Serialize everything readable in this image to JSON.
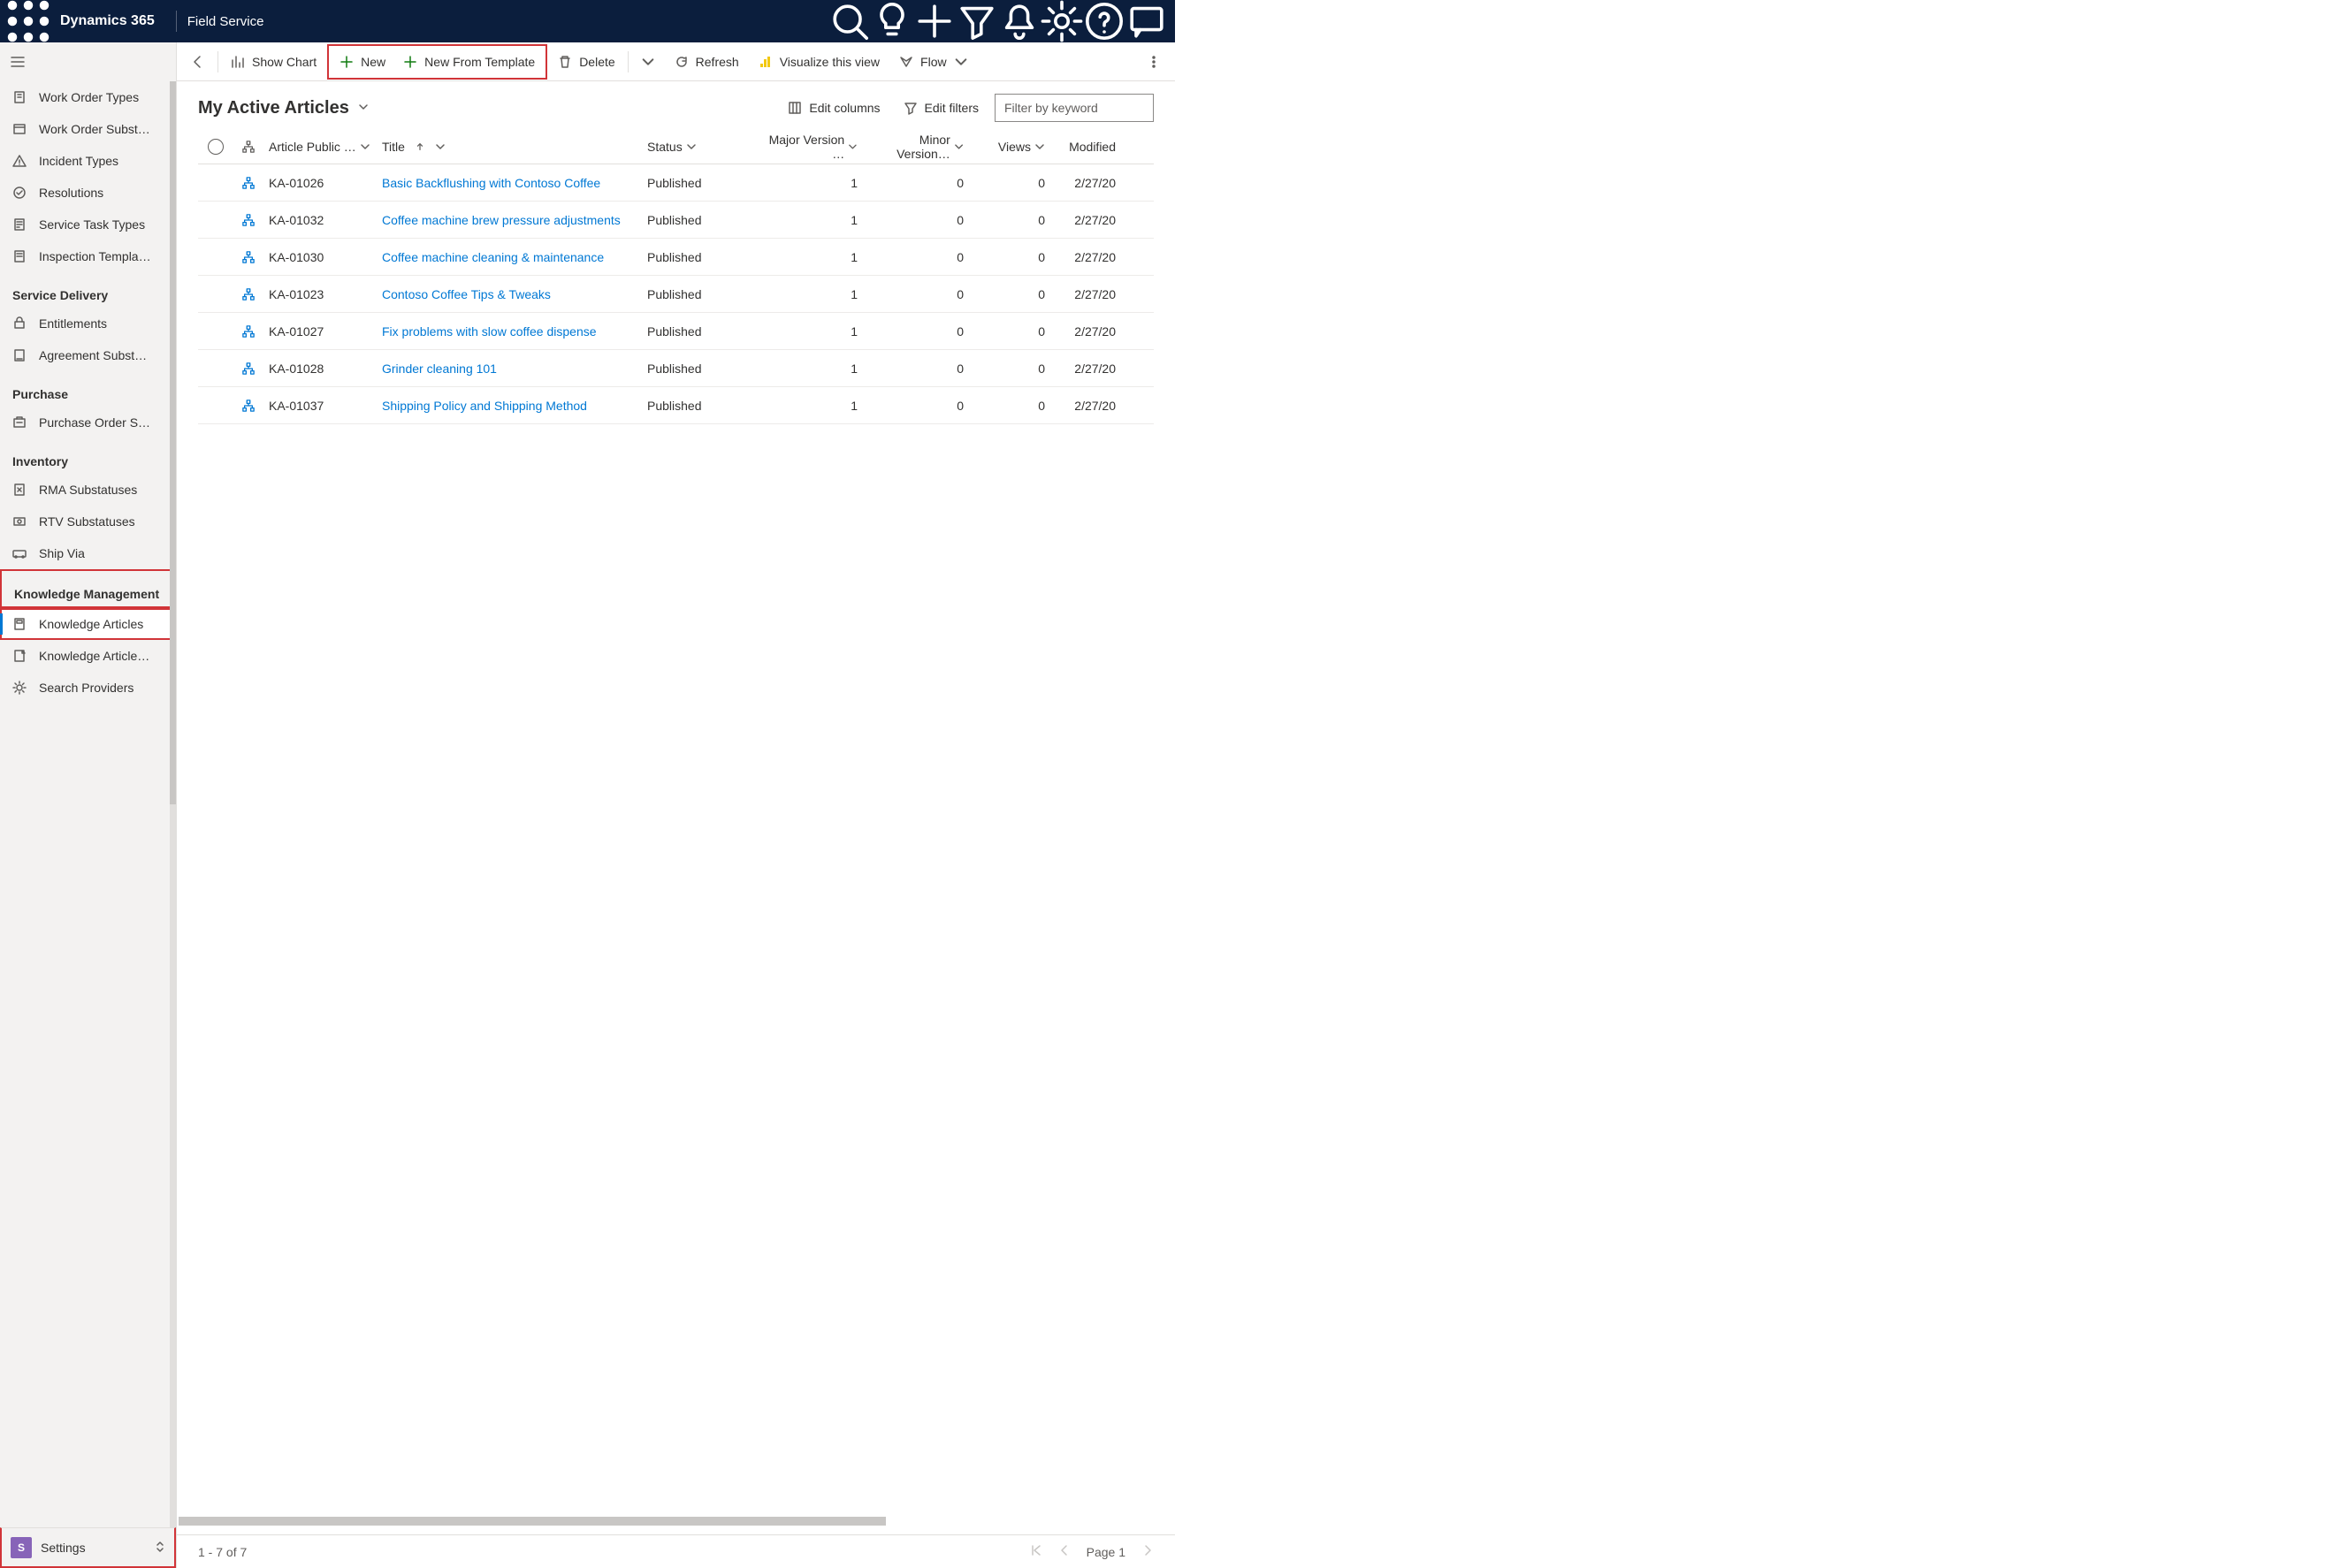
{
  "header": {
    "brand": "Dynamics 365",
    "app_name": "Field Service"
  },
  "sidebar": {
    "items_top": [
      {
        "label": "Work Order Types"
      },
      {
        "label": "Work Order Subst…"
      },
      {
        "label": "Incident Types"
      },
      {
        "label": "Resolutions"
      },
      {
        "label": "Service Task Types"
      },
      {
        "label": "Inspection Templa…"
      }
    ],
    "groups": [
      {
        "title": "Service Delivery",
        "items": [
          {
            "label": "Entitlements"
          },
          {
            "label": "Agreement Subst…"
          }
        ]
      },
      {
        "title": "Purchase",
        "items": [
          {
            "label": "Purchase Order S…"
          }
        ]
      },
      {
        "title": "Inventory",
        "items": [
          {
            "label": "RMA Substatuses"
          },
          {
            "label": "RTV Substatuses"
          },
          {
            "label": "Ship Via"
          }
        ]
      },
      {
        "title": "Knowledge Management",
        "highlighted": true,
        "items": [
          {
            "label": "Knowledge Articles",
            "selected": true
          },
          {
            "label": "Knowledge Article…"
          },
          {
            "label": "Search Providers"
          }
        ]
      }
    ],
    "area": {
      "badge": "S",
      "label": "Settings"
    }
  },
  "commands": {
    "show_chart": "Show Chart",
    "new": "New",
    "new_from_template": "New From Template",
    "delete": "Delete",
    "refresh": "Refresh",
    "visualize": "Visualize this view",
    "flow": "Flow"
  },
  "view": {
    "title": "My Active Articles",
    "edit_columns": "Edit columns",
    "edit_filters": "Edit filters",
    "filter_placeholder": "Filter by keyword"
  },
  "grid": {
    "columns": {
      "article_public": "Article Public …",
      "title": "Title",
      "status": "Status",
      "major": "Major Version …",
      "minor": "Minor Version…",
      "views": "Views",
      "modified": "Modified"
    },
    "rows": [
      {
        "pub": "KA-01026",
        "title": "Basic Backflushing with Contoso Coffee",
        "status": "Published",
        "major": "1",
        "minor": "0",
        "views": "0",
        "mod": "2/27/20"
      },
      {
        "pub": "KA-01032",
        "title": "Coffee machine brew pressure adjustments",
        "status": "Published",
        "major": "1",
        "minor": "0",
        "views": "0",
        "mod": "2/27/20"
      },
      {
        "pub": "KA-01030",
        "title": "Coffee machine cleaning & maintenance",
        "status": "Published",
        "major": "1",
        "minor": "0",
        "views": "0",
        "mod": "2/27/20"
      },
      {
        "pub": "KA-01023",
        "title": "Contoso Coffee Tips & Tweaks",
        "status": "Published",
        "major": "1",
        "minor": "0",
        "views": "0",
        "mod": "2/27/20"
      },
      {
        "pub": "KA-01027",
        "title": "Fix problems with slow coffee dispense",
        "status": "Published",
        "major": "1",
        "minor": "0",
        "views": "0",
        "mod": "2/27/20"
      },
      {
        "pub": "KA-01028",
        "title": "Grinder cleaning 101",
        "status": "Published",
        "major": "1",
        "minor": "0",
        "views": "0",
        "mod": "2/27/20"
      },
      {
        "pub": "KA-01037",
        "title": "Shipping Policy and Shipping Method",
        "status": "Published",
        "major": "1",
        "minor": "0",
        "views": "0",
        "mod": "2/27/20"
      }
    ]
  },
  "footer": {
    "range": "1 - 7 of 7",
    "page": "Page 1"
  }
}
